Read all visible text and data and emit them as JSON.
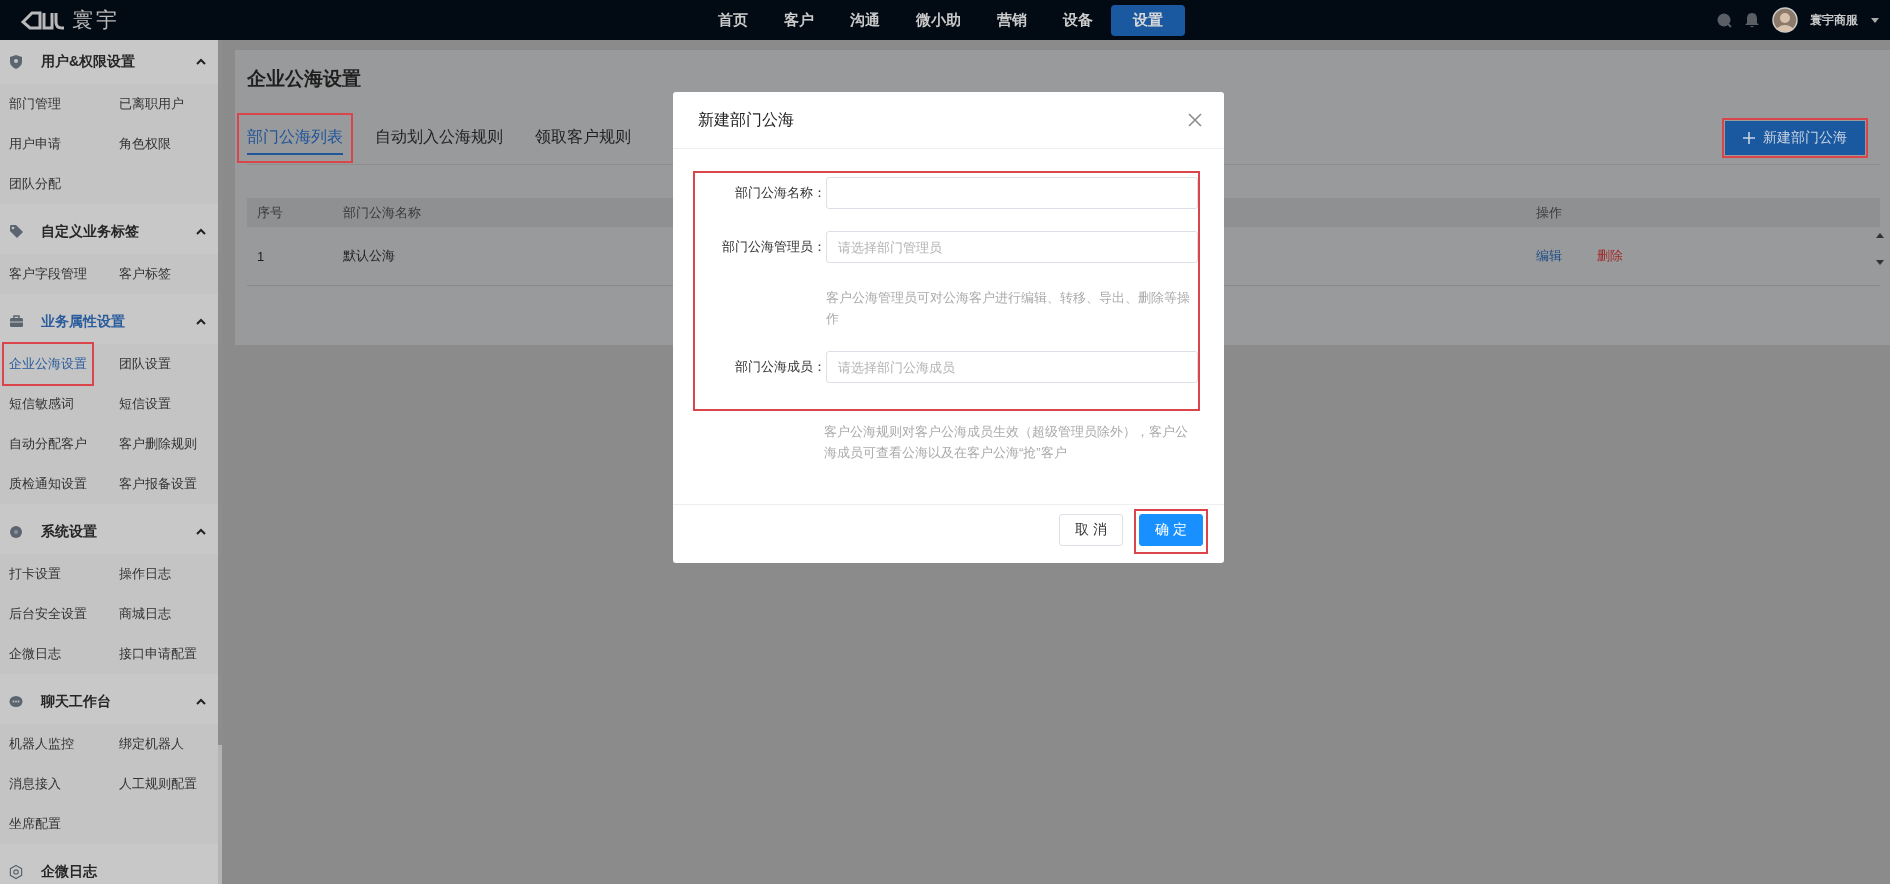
{
  "top_bar": {
    "logo_text": "寰宇",
    "nav": [
      {
        "label": "首页",
        "selected": false
      },
      {
        "label": "客户",
        "selected": false
      },
      {
        "label": "沟通",
        "selected": false
      },
      {
        "label": "微小助",
        "selected": false
      },
      {
        "label": "营销",
        "selected": false
      },
      {
        "label": "设备",
        "selected": false
      },
      {
        "label": "设置",
        "selected": true
      }
    ],
    "user_name": "寰宇商服"
  },
  "sidebar": {
    "groups": [
      {
        "title": "用户&权限设置",
        "kind": "shield",
        "selected": false,
        "expanded": true,
        "items": [
          {
            "label": "部门管理",
            "selected": false,
            "highlighted": false
          },
          {
            "label": "已离职用户",
            "selected": false,
            "highlighted": false
          },
          {
            "label": "用户申请",
            "selected": false,
            "highlighted": false
          },
          {
            "label": "角色权限",
            "selected": false,
            "highlighted": false
          },
          {
            "label": "团队分配",
            "selected": false,
            "highlighted": false
          }
        ]
      },
      {
        "title": "自定义业务标签",
        "kind": "tag",
        "selected": false,
        "expanded": true,
        "items": [
          {
            "label": "客户字段管理",
            "selected": false,
            "highlighted": false
          },
          {
            "label": "客户标签",
            "selected": false,
            "highlighted": false
          }
        ]
      },
      {
        "title": "业务属性设置",
        "kind": "briefcase",
        "selected": true,
        "expanded": true,
        "items": [
          {
            "label": "企业公海设置",
            "selected": true,
            "highlighted": true
          },
          {
            "label": "团队设置",
            "selected": false,
            "highlighted": false
          },
          {
            "label": "短信敏感词",
            "selected": false,
            "highlighted": false
          },
          {
            "label": "短信设置",
            "selected": false,
            "highlighted": false
          },
          {
            "label": "自动分配客户",
            "selected": false,
            "highlighted": false
          },
          {
            "label": "客户删除规则",
            "selected": false,
            "highlighted": false
          },
          {
            "label": "质检通知设置",
            "selected": false,
            "highlighted": false
          },
          {
            "label": "客户报备设置",
            "selected": false,
            "highlighted": false
          }
        ]
      },
      {
        "title": "系统设置",
        "kind": "gear",
        "selected": false,
        "expanded": true,
        "items": [
          {
            "label": "打卡设置",
            "selected": false,
            "highlighted": false
          },
          {
            "label": "操作日志",
            "selected": false,
            "highlighted": false
          },
          {
            "label": "后台安全设置",
            "selected": false,
            "highlighted": false
          },
          {
            "label": "商城日志",
            "selected": false,
            "highlighted": false
          },
          {
            "label": "企微日志",
            "selected": false,
            "highlighted": false
          },
          {
            "label": "接口申请配置",
            "selected": false,
            "highlighted": false
          }
        ]
      },
      {
        "title": "聊天工作台",
        "kind": "chat",
        "selected": false,
        "expanded": true,
        "items": [
          {
            "label": "机器人监控",
            "selected": false,
            "highlighted": false
          },
          {
            "label": "绑定机器人",
            "selected": false,
            "highlighted": false
          },
          {
            "label": "消息接入",
            "selected": false,
            "highlighted": false
          },
          {
            "label": "人工规则配置",
            "selected": false,
            "highlighted": false
          },
          {
            "label": "坐席配置",
            "selected": false,
            "highlighted": false
          }
        ]
      },
      {
        "title": "企微日志",
        "kind": "ring",
        "selected": false
      }
    ]
  },
  "main": {
    "title": "企业公海设置",
    "tabs": [
      {
        "label": "部门公海列表",
        "selected": true,
        "highlighted": true
      },
      {
        "label": "自动划入公海规则",
        "selected": false,
        "highlighted": false
      },
      {
        "label": "领取客户规则",
        "selected": false,
        "highlighted": false
      }
    ],
    "new_button": {
      "label": "新建部门公海",
      "highlighted": true
    },
    "table": {
      "columns": [
        "序号",
        "部门公海名称",
        "操作"
      ],
      "rows": [
        {
          "cells": [
            "1",
            "默认公海"
          ],
          "actions": [
            {
              "label": "编辑",
              "kind": "edit"
            },
            {
              "label": "删除",
              "kind": "delete"
            }
          ]
        }
      ]
    }
  },
  "modal": {
    "title": "新建部门公海",
    "form_highlighted": true,
    "fields": [
      {
        "label": "部门公海名称："
      },
      {
        "label": "部门公海管理员：",
        "placeholder": "请选择部门管理员",
        "hint": "客户公海管理员可对公海客户进行编辑、转移、导出、删除等操作"
      },
      {
        "label": "部门公海成员：",
        "placeholder": "请选择部门公海成员",
        "hint": "客户公海规则对客户公海成员生效（超级管理员除外），客户公海成员可查看公海以及在客户公海“抢”客户"
      }
    ],
    "buttons": [
      {
        "label": "取 消",
        "kind": "cancel",
        "highlighted": false
      },
      {
        "label": "确 定",
        "kind": "primary",
        "highlighted": true
      }
    ]
  }
}
